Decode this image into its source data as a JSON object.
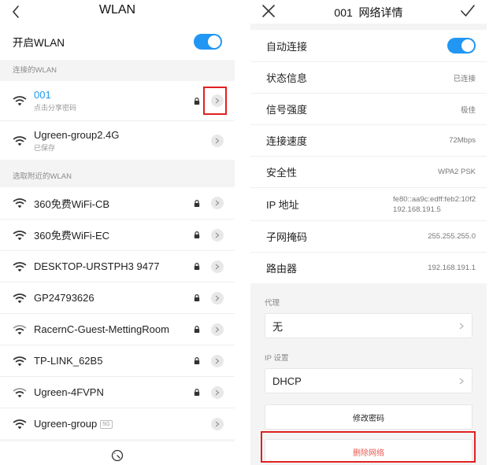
{
  "left": {
    "title": "WLAN",
    "toggle_label": "开启WLAN",
    "toggle_on": true,
    "connected_section_label": "连接的WLAN",
    "connected": [
      {
        "name": "001",
        "sub": "点击分享密码",
        "active": true,
        "locked": true
      },
      {
        "name": "Ugreen-group2.4G",
        "sub": "已保存",
        "active": false,
        "locked": false
      }
    ],
    "nearby_section_label": "选取附近的WLAN",
    "nearby": [
      {
        "name": "360免费WiFi-CB",
        "locked": true,
        "badge": ""
      },
      {
        "name": "360免费WiFi-EC",
        "locked": true,
        "badge": ""
      },
      {
        "name": "DESKTOP-URSTPH3 9477",
        "locked": true,
        "badge": ""
      },
      {
        "name": "GP24793626",
        "locked": true,
        "badge": ""
      },
      {
        "name": "RacernC-Guest-MettingRoom",
        "locked": true,
        "badge": ""
      },
      {
        "name": "TP-LINK_62B5",
        "locked": true,
        "badge": ""
      },
      {
        "name": "Ugreen-4FVPN",
        "locked": true,
        "badge": ""
      },
      {
        "name": "Ugreen-group",
        "locked": false,
        "badge": "5G"
      }
    ]
  },
  "right": {
    "title": "001  网络详情",
    "auto_connect_label": "自动连接",
    "auto_connect_on": true,
    "details": [
      {
        "label": "状态信息",
        "value": "已连接"
      },
      {
        "label": "信号强度",
        "value": "极佳"
      },
      {
        "label": "连接速度",
        "value": "72Mbps"
      },
      {
        "label": "安全性",
        "value": "WPA2 PSK"
      },
      {
        "label": "IP 地址",
        "value_line1": "fe80::aa9c:edff:feb2:10f2",
        "value_line2": "192.168.191.5"
      },
      {
        "label": "子网掩码",
        "value": "255.255.255.0"
      },
      {
        "label": "路由器",
        "value": "192.168.191.1"
      }
    ],
    "proxy_label": "代理",
    "proxy_value": "无",
    "ip_settings_label": "IP 设置",
    "ip_settings_value": "DHCP",
    "change_password_label": "修改密码",
    "delete_network_label": "删除网络"
  },
  "colors": {
    "accent": "#2196f3",
    "active_text": "#1e9be8",
    "highlight": "#e02020",
    "danger_text": "#e85a4f"
  },
  "icons": [
    "back-icon",
    "close-icon",
    "check-icon",
    "wifi-icon",
    "lock-icon",
    "chevron-right-icon",
    "gauge-icon"
  ]
}
